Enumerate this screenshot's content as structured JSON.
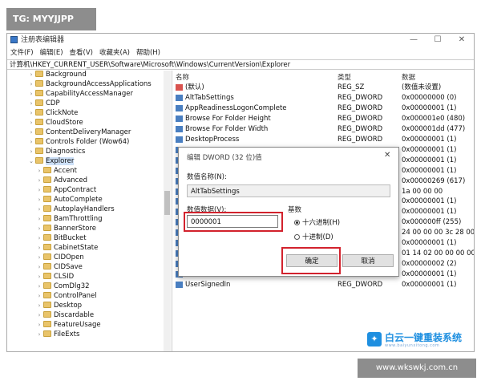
{
  "watermark": {
    "tg": "TG: MYYJJPP",
    "site": "www.wkswkj.com.cn",
    "brand_name": "白云一键重装系统",
    "brand_url": "www.baiyunxitong.com"
  },
  "window": {
    "title": "注册表编辑器",
    "min": "—",
    "max": "☐",
    "close": "✕"
  },
  "menu": [
    "文件(F)",
    "编辑(E)",
    "查看(V)",
    "收藏夹(A)",
    "帮助(H)"
  ],
  "address": "计算机\\HKEY_CURRENT_USER\\Software\\Microsoft\\Windows\\CurrentVersion\\Explorer",
  "tree": [
    {
      "label": "Background"
    },
    {
      "label": "BackgroundAccessApplications"
    },
    {
      "label": "CapabilityAccessManager"
    },
    {
      "label": "CDP"
    },
    {
      "label": "ClickNote"
    },
    {
      "label": "CloudStore"
    },
    {
      "label": "ContentDeliveryManager"
    },
    {
      "label": "Controls Folder (Wow64)"
    },
    {
      "label": "Diagnostics"
    },
    {
      "label": "Explorer"
    },
    {
      "label": "Accent"
    },
    {
      "label": "Advanced"
    },
    {
      "label": "AppContract"
    },
    {
      "label": "AutoComplete"
    },
    {
      "label": "AutoplayHandlers"
    },
    {
      "label": "BamThrottling"
    },
    {
      "label": "BannerStore"
    },
    {
      "label": "BitBucket"
    },
    {
      "label": "CabinetState"
    },
    {
      "label": "CIDOpen"
    },
    {
      "label": "CIDSave"
    },
    {
      "label": "CLSID"
    },
    {
      "label": "ComDlg32"
    },
    {
      "label": "ControlPanel"
    },
    {
      "label": "Desktop"
    },
    {
      "label": "Discardable"
    },
    {
      "label": "FeatureUsage"
    },
    {
      "label": "FileExts"
    }
  ],
  "values": {
    "headers": {
      "name": "名称",
      "type": "类型",
      "data": "数据"
    },
    "rows": [
      {
        "name": "(默认)",
        "type": "REG_SZ",
        "data": "(数值未设置)"
      },
      {
        "name": "AltTabSettings",
        "type": "REG_DWORD",
        "data": "0x00000000 (0)"
      },
      {
        "name": "AppReadinessLogonComplete",
        "type": "REG_DWORD",
        "data": "0x00000001 (1)"
      },
      {
        "name": "Browse For Folder Height",
        "type": "REG_DWORD",
        "data": "0x000001e0 (480)"
      },
      {
        "name": "Browse For Folder Width",
        "type": "REG_DWORD",
        "data": "0x000001dd (477)"
      },
      {
        "name": "DesktopProcess",
        "type": "REG_DWORD",
        "data": "0x00000001 (1)"
      },
      {
        "name": "",
        "type": "",
        "data": "0x00000001 (1)"
      },
      {
        "name": "",
        "type": "",
        "data": "0x00000001 (1)"
      },
      {
        "name": "",
        "type": "",
        "data": "0x00000001 (1)"
      },
      {
        "name": "",
        "type": "",
        "data": "0x00000269 (617)"
      },
      {
        "name": "",
        "type": "",
        "data": "1a 00 00 00"
      },
      {
        "name": "",
        "type": "",
        "data": "0x00000001 (1)"
      },
      {
        "name": "",
        "type": "",
        "data": "0x00000001 (1)"
      },
      {
        "name": "",
        "type": "",
        "data": "0x000000ff (255)"
      },
      {
        "name": "",
        "type": "",
        "data": "24 00 00 00 3c 28 00 00"
      },
      {
        "name": "",
        "type": "",
        "data": "0x00000001 (1)"
      },
      {
        "name": "",
        "type": "",
        "data": "01 14 02 00 00 00 00 00"
      },
      {
        "name": "",
        "type": "",
        "data": "0x00000002 (2)"
      },
      {
        "name": "",
        "type": "",
        "data": "0x00000001 (1)"
      },
      {
        "name": "UserSignedIn",
        "type": "REG_DWORD",
        "data": "0x00000001 (1)"
      }
    ]
  },
  "dialog": {
    "title": "编辑 DWORD (32 位)值",
    "close": "✕",
    "name_label": "数值名称(N):",
    "name_value": "AltTabSettings",
    "data_label": "数值数据(V):",
    "data_value": "0000001",
    "base_label": "基数",
    "radio_hex": "十六进制(H)",
    "radio_dec": "十进制(D)",
    "ok": "确定",
    "cancel": "取消"
  },
  "colors": {
    "highlight": "#d2222d",
    "selection": "#cde0f7",
    "folder": "#e9c46a",
    "brand": "#1e8fe0"
  }
}
